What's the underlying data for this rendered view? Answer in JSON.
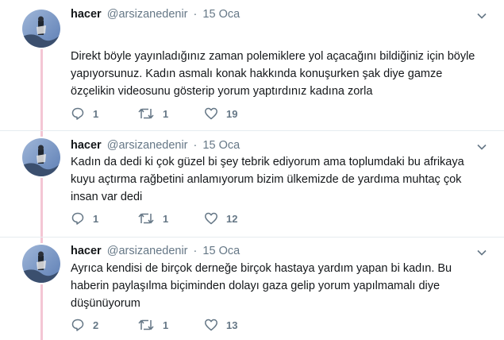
{
  "tweets": [
    {
      "author_name": "hacer",
      "handle": "@arsizanedenir",
      "date": "15 Oca",
      "text": "Direkt böyle yayınladığınız zaman polemiklere yol açacağını bildiğiniz için böyle yapıyorsunuz. Kadın asmalı konak hakkında konuşurken şak diye gamze özçelikin videosunu gösterip yorum yaptırdınız kadına zorla",
      "replies": "1",
      "retweets": "1",
      "likes": "19"
    },
    {
      "author_name": "hacer",
      "handle": "@arsizanedenir",
      "date": "15 Oca",
      "text": "Kadın da dedi ki çok güzel bi şey tebrik ediyorum ama toplumdaki bu afrikaya kuyu açtırma rağbetini anlamıyorum bizim ülkemizde de yardıma muhtaç çok insan var dedi",
      "replies": "1",
      "retweets": "1",
      "likes": "12"
    },
    {
      "author_name": "hacer",
      "handle": "@arsizanedenir",
      "date": "15 Oca",
      "text": "Ayrıca kendisi de birçok derneğe birçok hastaya yardım yapan bi kadın. Bu haberin paylaşılma biçiminden dolayı gaza gelip yorum yapılmamalı diye düşünüyorum",
      "replies": "2",
      "retweets": "1",
      "likes": "13"
    }
  ],
  "colors": {
    "thread_line": "#f4c6d4",
    "meta_text": "#657786",
    "divider": "#e6ecf0"
  }
}
